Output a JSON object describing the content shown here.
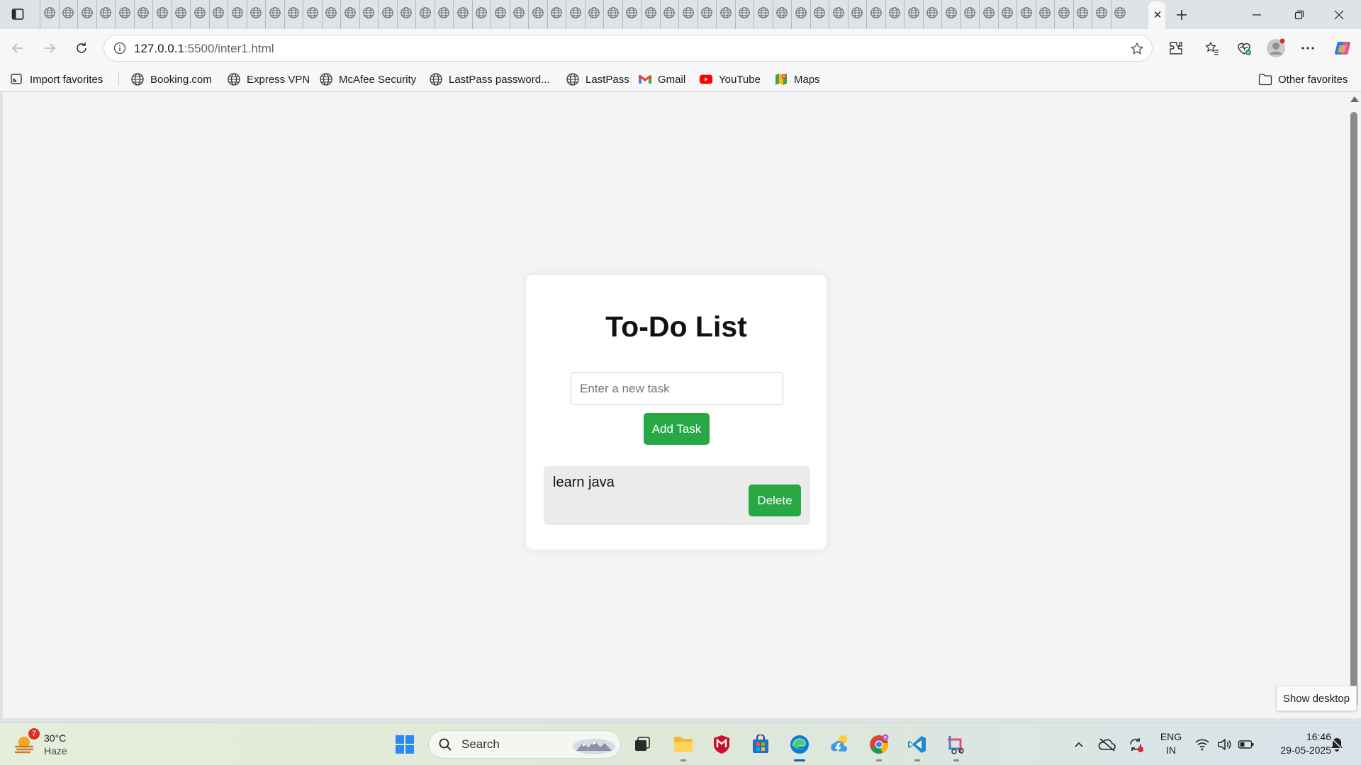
{
  "browser": {
    "mini_tab_count": 58,
    "active_tab_close": "✕",
    "url_host": "127.0.0.1",
    "url_path": ":5500/inter1.html"
  },
  "bookmarks": {
    "import_favorites": "Import favorites",
    "items": [
      {
        "label": "Booking.com",
        "icon": "globe-icon"
      },
      {
        "label": "Express VPN",
        "icon": "globe-icon"
      },
      {
        "label": "McAfee Security",
        "icon": "globe-icon"
      },
      {
        "label": "LastPass password...",
        "icon": "globe-icon"
      },
      {
        "label": "LastPass",
        "icon": "globe-icon"
      },
      {
        "label": "Gmail",
        "icon": "gmail-icon"
      },
      {
        "label": "YouTube",
        "icon": "youtube-icon"
      },
      {
        "label": "Maps",
        "icon": "maps-icon"
      }
    ],
    "other_favorites": "Other favorites"
  },
  "app": {
    "title": "To-Do List",
    "input_placeholder": "Enter a new task",
    "input_value": "",
    "add_button": "Add Task",
    "tasks": [
      {
        "text": "learn java",
        "delete_label": "Delete"
      }
    ]
  },
  "overlay": {
    "show_desktop": "Show desktop"
  },
  "taskbar": {
    "weather_temp": "30°C",
    "weather_condition": "Haze",
    "weather_badge": "7",
    "search_label": "Search",
    "lang_line1": "ENG",
    "lang_line2": "IN",
    "time": "16:46",
    "date": "29-05-2025"
  },
  "colors": {
    "accent_green": "#28a745",
    "edge_blue": "#0067c0"
  }
}
